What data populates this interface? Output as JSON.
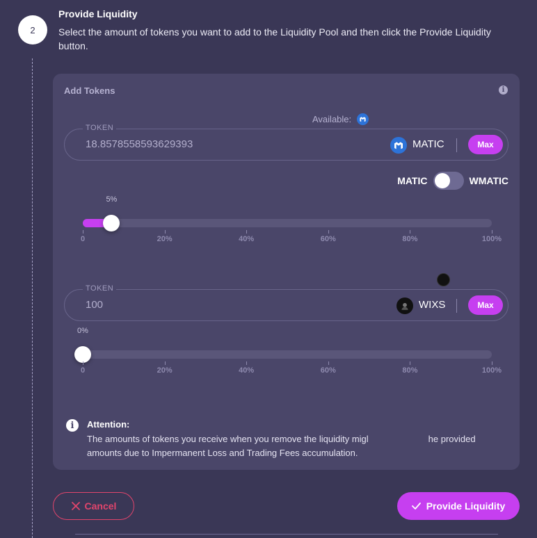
{
  "step": {
    "number": "2",
    "title": "Provide Liquidity",
    "description": "Select the amount of tokens you want to add to the Liquidity Pool and then click the Provide Liquidity button."
  },
  "card": {
    "title": "Add Tokens",
    "available_label": "Available:"
  },
  "token_a": {
    "label": "TOKEN",
    "amount": "18.8578558593629393",
    "symbol": "MATIC",
    "max_label": "Max",
    "logo_icon": "matic-logo-icon"
  },
  "toggle": {
    "left_label": "MATIC",
    "right_label": "WMATIC",
    "state": "off"
  },
  "slider_a": {
    "value_label": "5%",
    "value": 5,
    "ticks": [
      "0",
      "20%",
      "40%",
      "60%",
      "80%",
      "100%"
    ]
  },
  "token_b": {
    "label": "TOKEN",
    "amount": "100",
    "symbol": "WIXS",
    "max_label": "Max",
    "logo_icon": "wixs-logo-icon"
  },
  "slider_b": {
    "value_label": "0%",
    "value": 0,
    "ticks": [
      "0",
      "20%",
      "40%",
      "60%",
      "80%",
      "100%"
    ]
  },
  "attention": {
    "title": "Attention:",
    "text_part1": "The amounts of tokens you receive when you remove the liquidity migl",
    "text_part2": "he provided",
    "text_line2": "amounts due to Impermanent Loss and Trading Fees accumulation."
  },
  "actions": {
    "cancel_label": "Cancel",
    "provide_label": "Provide Liquidity"
  },
  "colors": {
    "accent": "#c63ff0",
    "cancel": "#e2456c",
    "background": "#3a3756",
    "card": "#4a4669"
  }
}
